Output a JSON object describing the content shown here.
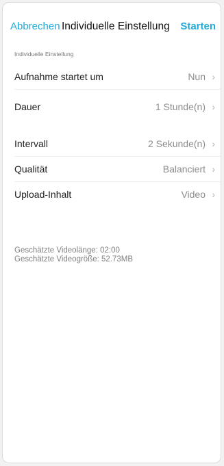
{
  "header": {
    "cancel_label": "Abbrechen",
    "title": "Individuelle Einstellung",
    "start_label": "Starten"
  },
  "section_label": "Individuelle Einstellung",
  "settings": [
    {
      "label": "Aufnahme startet um",
      "value": "Nun"
    },
    {
      "label": "Dauer",
      "value": "1 Stunde(n)"
    },
    {
      "label": "Intervall",
      "value": "2 Sekunde(n)"
    },
    {
      "label": "Qualität",
      "value": "Balanciert"
    },
    {
      "label": "Upload-Inhalt",
      "value": "Video"
    }
  ],
  "estimates": {
    "video_length": "Geschätzte Videolänge: 02:00",
    "video_size": "Geschätzte Videogröße: 52.73MB"
  },
  "icons": {
    "chevron": "chevron-right-icon"
  },
  "colors": {
    "accent": "#22a9d6",
    "background": "#ffffff",
    "border": "#dcdcdc"
  }
}
